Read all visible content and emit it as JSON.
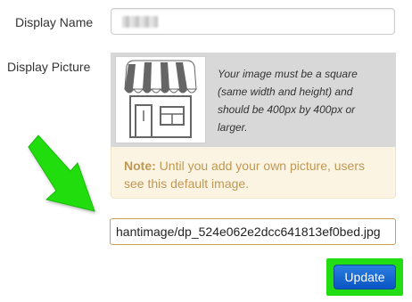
{
  "form": {
    "display_name_label": "Display Name",
    "display_picture_label": "Display Picture",
    "picture_hint": "Your image must be a square (same width and height) and should be 400px by 400px or larger.",
    "note_title": "Note:",
    "note_body": "Until you add your own picture, users see this default image.",
    "file_path_value": "hantimage/dp_524e062e2dcc641813ef0bed.jpg",
    "update_label": "Update"
  },
  "colors": {
    "note_text": "#c09853",
    "note_background": "#fbf4e3",
    "button_blue": "#0a55c4",
    "highlight_green": "#22dd11"
  },
  "icons": {
    "default_picture": "storefront-icon",
    "annotation": "arrow-icon"
  }
}
